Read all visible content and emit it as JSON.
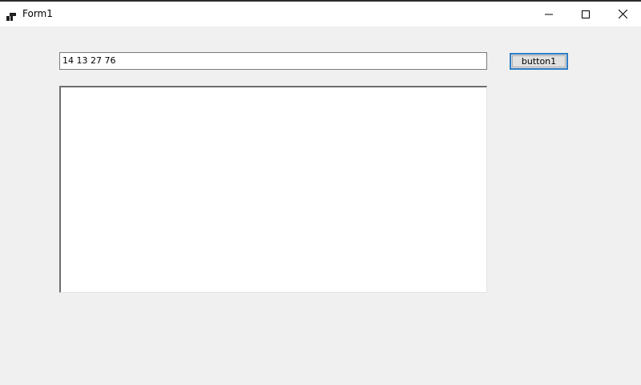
{
  "window": {
    "title": "Form1"
  },
  "titlebar": {
    "app_icon": "form-app-icon",
    "minimize_icon": "minimize-icon",
    "maximize_icon": "maximize-icon",
    "close_icon": "close-icon"
  },
  "form": {
    "textbox_value": "14 13 27 76",
    "button_label": "button1",
    "listbox_items": []
  },
  "colors": {
    "background": "#f0f0f0",
    "titlebar": "#ffffff",
    "button_focus_border": "#2d7dc4",
    "button_face": "#e1e1e1"
  }
}
